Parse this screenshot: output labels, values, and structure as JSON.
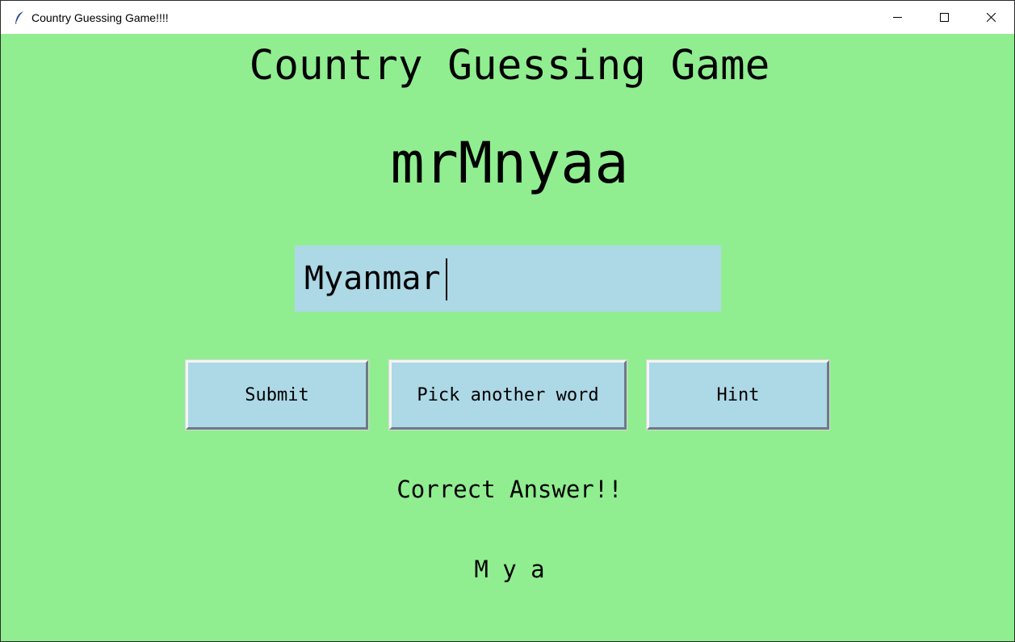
{
  "window": {
    "title": "Country Guessing Game!!!!",
    "icon": "feather-icon",
    "controls": [
      "minimize-icon",
      "maximize-icon",
      "close-icon"
    ]
  },
  "app": {
    "heading": "Country Guessing Game",
    "scrambled_word": "mrMnyaa",
    "answer_input_value": "Myanmar",
    "buttons": {
      "submit": "Submit",
      "pick_another": "Pick another word",
      "hint": "Hint"
    },
    "status_message": "Correct Answer!!",
    "hint_text": "M y a"
  },
  "colors": {
    "background": "#90ee90",
    "entry_background": "#add8e6",
    "button_background": "#add8e6"
  }
}
